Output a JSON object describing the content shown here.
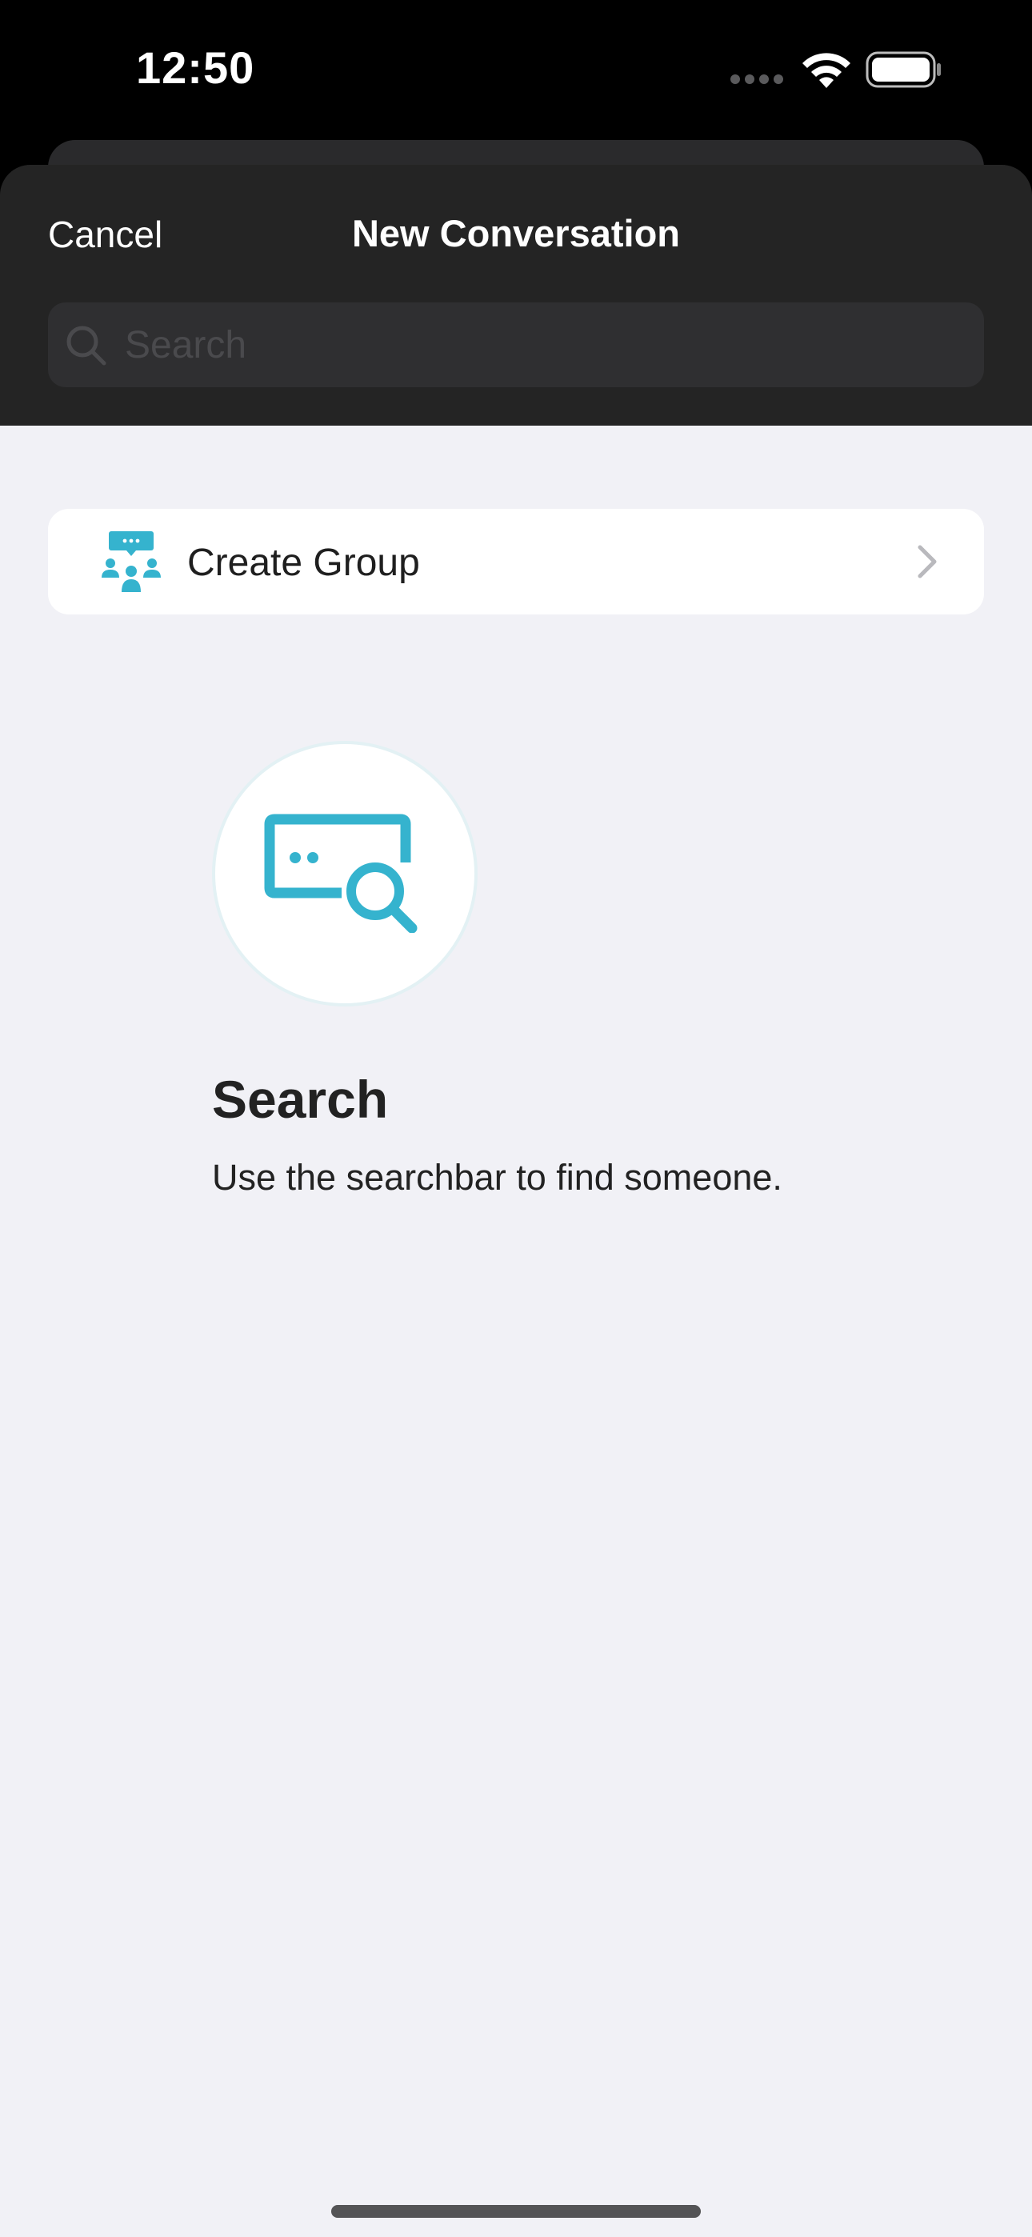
{
  "status_bar": {
    "time": "12:50",
    "icons": [
      "cellular-signal-icon",
      "wifi-icon",
      "battery-icon"
    ]
  },
  "header": {
    "cancel_label": "Cancel",
    "title": "New Conversation"
  },
  "search": {
    "placeholder": "Search",
    "value": ""
  },
  "create_group": {
    "label": "Create Group",
    "icon": "group-chat-icon"
  },
  "empty_state": {
    "icon": "message-search-icon",
    "title": "Search",
    "subtitle": "Use the searchbar to find someone."
  },
  "colors": {
    "accent": "#35b3ce",
    "header_bg": "#242424",
    "content_bg": "#f1f1f6"
  }
}
